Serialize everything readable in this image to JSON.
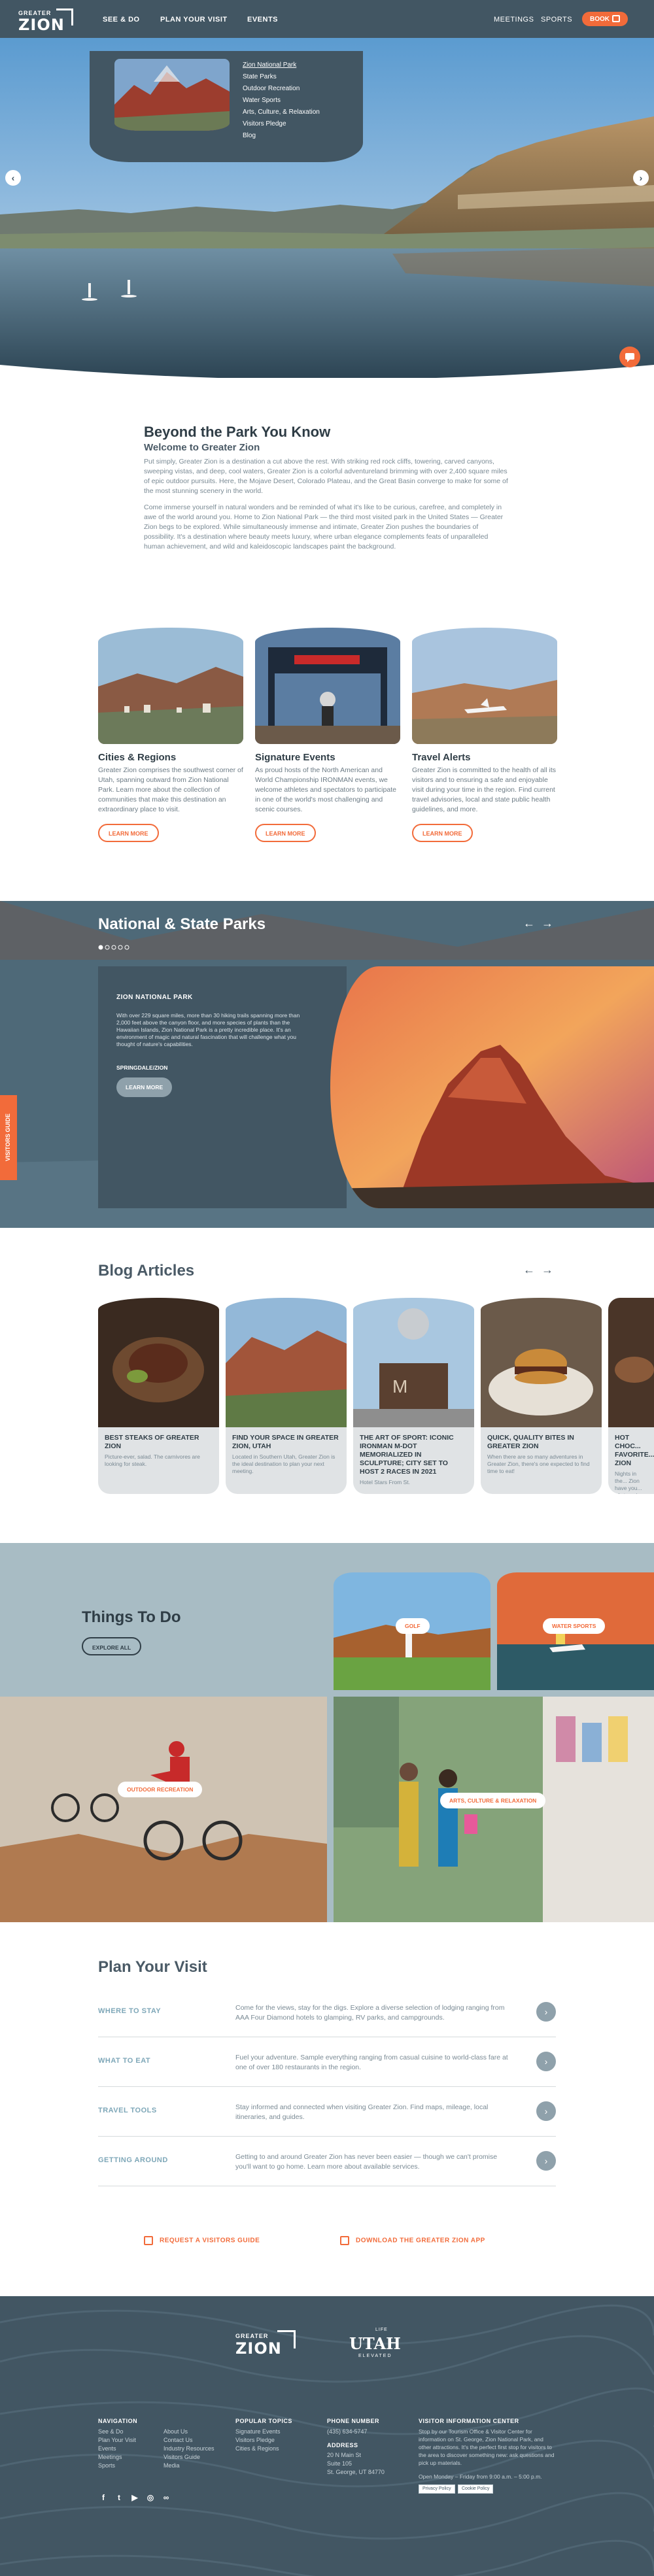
{
  "nav": {
    "logo_small": "GREATER",
    "logo_big": "ZION",
    "links": [
      "SEE & DO",
      "PLAN YOUR VISIT",
      "EVENTS"
    ],
    "right_links": [
      "MEETINGS",
      "SPORTS"
    ],
    "book_label": "BOOK"
  },
  "dropdown": {
    "items": [
      "Zion National Park",
      "State Parks",
      "Outdoor Recreation",
      "Water Sports",
      "Arts, Culture, & Relaxation",
      "Visitors Pledge",
      "Blog"
    ]
  },
  "intro": {
    "title": "Beyond the Park You Know",
    "subtitle": "Welcome to Greater Zion",
    "para1": "Put simply, Greater Zion is a destination a cut above the rest. With striking red rock cliffs, towering, carved canyons, sweeping vistas, and deep, cool waters, Greater Zion is a colorful adventureland brimming with over 2,400 square miles of epic outdoor pursuits. Here, the Mojave Desert, Colorado Plateau, and the Great Basin converge to make for some of the most stunning scenery in the world.",
    "para2": "Come immerse yourself in natural wonders and be reminded of what it's like to be curious, carefree, and completely in awe of the world around you. Home to Zion National Park — the third most visited park in the United States — Greater Zion begs to be explored. While simultaneously immense and intimate, Greater Zion pushes the boundaries of possibility. It's a destination where beauty meets luxury, where urban elegance complements feats of unparalleled human achievement, and wild and kaleidoscopic landscapes paint the background."
  },
  "cards": [
    {
      "title": "Cities & Regions",
      "text": "Greater Zion comprises the southwest corner of Utah, spanning outward from Zion National Park. Learn more about the collection of communities that make this destination an extraordinary place to visit.",
      "button": "LEARN MORE"
    },
    {
      "title": "Signature Events",
      "text": "As proud hosts of the North American and World Championship IRONMAN events, we welcome athletes and spectators to participate in one of the world's most challenging and scenic courses.",
      "button": "LEARN MORE"
    },
    {
      "title": "Travel Alerts",
      "text": "Greater Zion is committed to the health of all its visitors and to ensuring a safe and enjoyable visit during your time in the region. Find current travel advisories, local and state public health guidelines, and more.",
      "button": "LEARN MORE"
    }
  ],
  "parks": {
    "title": "National & State Parks",
    "card_title": "ZION NATIONAL PARK",
    "card_text": "With over 229 square miles, more than 30 hiking trails spanning more than 2,000 feet above the canyon floor, and more species of plants than the Hawaiian Islands, Zion National Park is a pretty incredible place. It's an environment of magic and natural fascination that will challenge what you thought of nature's capabilities.",
    "location": "SPRINGDALE/ZION",
    "button": "LEARN MORE",
    "side_tab": "VISITORS GUIDE"
  },
  "blog": {
    "title": "Blog Articles",
    "posts": [
      {
        "title": "BEST STEAKS OF GREATER ZION",
        "text": "Picture-ever, salad. The carnivores are looking for steak."
      },
      {
        "title": "FIND YOUR SPACE IN GREATER ZION, UTAH",
        "text": "Located in Southern Utah, Greater Zion is the ideal destination to plan your next meeting."
      },
      {
        "title": "THE ART OF SPORT: ICONIC IRONMAN M-DOT MEMORIALIZED IN SCULPTURE; CITY SET TO HOST 2 RACES IN 2021",
        "text": "Hotel Stars From St."
      },
      {
        "title": "QUICK, QUALITY BITES IN GREATER ZION",
        "text": "When there are so many adventures in Greater Zion, there's one expected to find time to eat!"
      },
      {
        "title": "HOT CHOC... FAVORITE... ZION",
        "text": "Nights in the... Zion have you... of steaming ho..."
      }
    ]
  },
  "things": {
    "title": "Things To Do",
    "button": "EXPLORE ALL",
    "tags": [
      "GOLF",
      "WATER SPORTS",
      "OUTDOOR RECREATION",
      "ARTS, CULTURE & RELAXATION"
    ]
  },
  "plan": {
    "title": "Plan Your Visit",
    "rows": [
      {
        "label": "WHERE TO STAY",
        "text": "Come for the views, stay for the digs. Explore a diverse selection of lodging ranging from AAA Four Diamond hotels to glamping, RV parks, and campgrounds."
      },
      {
        "label": "WHAT TO EAT",
        "text": "Fuel your adventure. Sample everything ranging from casual cuisine to world-class fare at one of over 180 restaurants in the region."
      },
      {
        "label": "TRAVEL TOOLS",
        "text": "Stay informed and connected when visiting Greater Zion. Find maps, mileage, local itineraries, and guides."
      },
      {
        "label": "GETTING AROUND",
        "text": "Getting to and around Greater Zion has never been easier — though we can't promise you'll want to go home. Learn more about available services."
      }
    ],
    "cta_guide": "REQUEST A VISITORS GUIDE",
    "cta_app": "DOWNLOAD THE GREATER ZION APP"
  },
  "footer": {
    "logo_small": "GREATER",
    "logo_big": "ZION",
    "partner_top": "LIFE",
    "partner_big": "UTAH",
    "partner_bottom": "ELEVATED",
    "nav_heading": "NAVIGATION",
    "nav_col1": [
      "See & Do",
      "Plan Your Visit",
      "Events",
      "Meetings",
      "Sports"
    ],
    "nav_col2": [
      "About Us",
      "Contact Us",
      "Industry Resources",
      "Visitors Guide",
      "Media"
    ],
    "topics_heading": "POPULAR TOPICS",
    "topics": [
      "Signature Events",
      "Visitors Pledge",
      "Cities & Regions"
    ],
    "phone_heading": "PHONE NUMBER",
    "phone": "(435) 634-5747",
    "address_heading": "ADDRESS",
    "address": [
      "20 N Main St",
      "Suite 105",
      "St. George, UT 84770"
    ],
    "center_heading": "VISITOR INFORMATION CENTER",
    "center_text": "Stop by our Tourism Office & Visitor Center for information on St. George, Zion National Park, and other attractions. It's the perfect first stop for visitors to the area to discover something new: ask questions and pick up materials.",
    "hours": "Open Monday – Friday from 9:00 a.m. – 5:00 p.m.",
    "privacy": "Privacy Policy",
    "cookie": "Cookie Policy"
  },
  "colors": {
    "nav": "#425663",
    "accent": "#f26b3a",
    "footer": "#425663",
    "things_bg": "#a8bcc4"
  }
}
